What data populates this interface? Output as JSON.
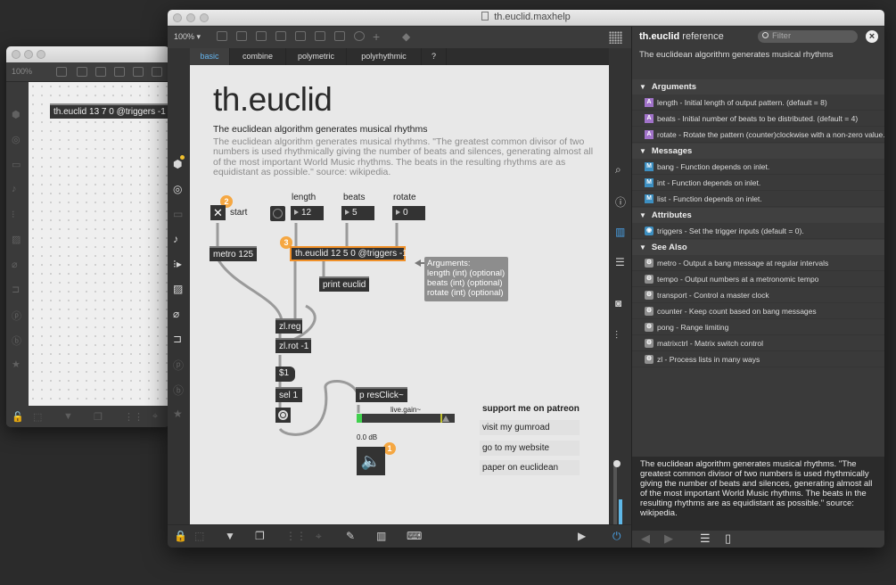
{
  "background_window": {
    "zoom": "100%",
    "object_text": "th.euclid 13 7 0 @triggers -1"
  },
  "window": {
    "title": "th.euclid.maxhelp",
    "zoom": "100%"
  },
  "tabs": [
    {
      "label": "basic",
      "active": true
    },
    {
      "label": "combine"
    },
    {
      "label": "polymetric"
    },
    {
      "label": "polyrhythmic"
    },
    {
      "label": "?"
    }
  ],
  "help": {
    "title": "th.euclid",
    "subtitle": "The euclidean algorithm generates musical rhythms",
    "description": "The euclidean algorithm generates musical rhythms. \"The greatest common divisor of two numbers is used rhythmically giving the number of beats and silences, generating almost all of the most important World Music rhythms. The beats in the resulting rhythms are as equidistant as possible.\" source: wikipedia.",
    "labels": {
      "length": "length",
      "beats": "beats",
      "rotate": "rotate",
      "start": "start",
      "gain_name": "live.gain~",
      "db": "0.0 dB"
    },
    "numbers": {
      "length": "12",
      "beats": "5",
      "rotate": "0"
    },
    "objects": {
      "metro": "metro 125",
      "euclid": "th.euclid 12 5 0 @triggers -1",
      "print": "print euclid",
      "zlreg": "zl.reg",
      "zlrot": "zl.rot -1",
      "msg": "$1",
      "sel": "sel 1",
      "resclick": "p resClick~"
    },
    "badges": [
      "2",
      "3",
      "1"
    ],
    "arguments": {
      "title": "Arguments:",
      "items": [
        "length (int) (optional)",
        "beats (int) (optional)",
        "rotate (int) (optional)"
      ]
    },
    "links": [
      "support me on patreon",
      "visit my gumroad",
      "go to my website",
      "paper on euclidean"
    ],
    "gain_level": 0.05
  },
  "reference": {
    "object": "th.euclid",
    "word": "reference",
    "filter_placeholder": "Filter",
    "intro": "The euclidean algorithm generates musical rhythms",
    "sections": {
      "arguments": {
        "title": "Arguments",
        "items": [
          {
            "name": "length",
            "text": " - Initial length of output pattern. (default = 8)"
          },
          {
            "name": "beats",
            "text": " - Initial number of beats to be distributed. (default = 4)"
          },
          {
            "name": "rotate",
            "text": " - Rotate the pattern (counter)clockwise with a non-zero value. (..."
          }
        ]
      },
      "messages": {
        "title": "Messages",
        "items": [
          {
            "name": "bang",
            "text": " - Function depends on inlet."
          },
          {
            "name": "int",
            "text": " - Function depends on inlet."
          },
          {
            "name": "list",
            "text": " - Function depends on inlet."
          }
        ]
      },
      "attributes": {
        "title": "Attributes",
        "items": [
          {
            "name": "triggers",
            "text": " - Set the trigger inputs (default = 0)."
          }
        ]
      },
      "see_also": {
        "title": "See Also",
        "items": [
          {
            "name": "metro",
            "text": " - Output a bang message at regular intervals"
          },
          {
            "name": "tempo",
            "text": " - Output numbers at a metronomic tempo"
          },
          {
            "name": "transport",
            "text": " - Control a master clock"
          },
          {
            "name": "counter",
            "text": " - Keep count based on bang messages"
          },
          {
            "name": "pong",
            "text": " - Range limiting"
          },
          {
            "name": "matrixctrl",
            "text": " - Matrix switch control"
          },
          {
            "name": "zl",
            "text": " - Process lists in many ways"
          }
        ]
      }
    },
    "description": "The euclidean algorithm generates musical rhythms. \"The greatest common divisor of two numbers is used rhythmically giving the number of beats and silences, generating almost all of the most important World Music rhythms. The beats in the resulting rhythms are as equidistant as possible.\" source: wikipedia."
  },
  "colors": {
    "accent_orange": "#f09029",
    "tab_active": "#66b7f2",
    "meter_green": "#40d04d"
  }
}
